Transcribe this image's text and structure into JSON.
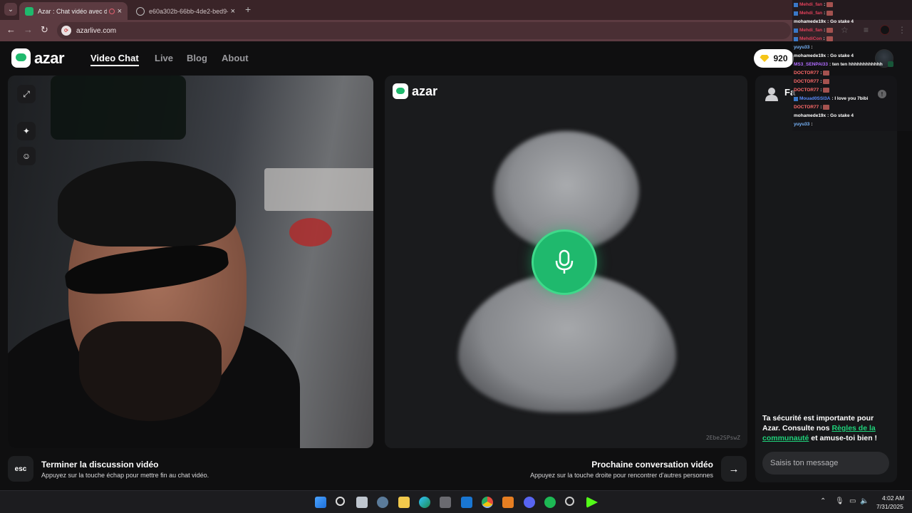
{
  "browser": {
    "tabs": [
      {
        "title": "Azar : Chat vidéo avec de n",
        "active": true
      },
      {
        "title": "e60a302b-66bb-4de2-bed9-5b",
        "active": false
      }
    ],
    "new_tab": "+",
    "url": "azarlive.com"
  },
  "header": {
    "logo_text": "azar",
    "nav": [
      "Video Chat",
      "Live",
      "Blog",
      "About"
    ],
    "gems": "920"
  },
  "remote": {
    "logo_text": "azar",
    "session_id": "2Ebe2SPswZ"
  },
  "chat_panel": {
    "partner_name": "Fa",
    "safety_part1": "Ta sécurité est importante pour Azar. Consulte nos ",
    "safety_link": "Règles de la communauté",
    "safety_part2": " et amuse-toi bien !",
    "input_placeholder": "Saisis ton message"
  },
  "bottom_bar": {
    "esc_label": "esc",
    "end_title": "Terminer la discussion vidéo",
    "end_hint": "Appuyez sur la touche échap pour mettre fin au chat vidéo.",
    "next_title": "Prochaine conversation vidéo",
    "next_hint": "Appuyez sur la touche droite pour rencontrer d'autres personnes"
  },
  "stream_chat": [
    {
      "user": "Mehdi_fan",
      "text": ":",
      "color": "#e0405a",
      "badge": true,
      "emote": true
    },
    {
      "user": "Mehdi_fan",
      "text": ":",
      "color": "#e0405a",
      "badge": true,
      "emote": true
    },
    {
      "user": "mohamede19x",
      "text": ": Go stake 4",
      "color": "#ffffff",
      "badge": false,
      "emote": false
    },
    {
      "user": "Mehdi_fan",
      "text": ":",
      "color": "#e0405a",
      "badge": true,
      "emote": true
    },
    {
      "user": "MehdiCon",
      "text": ":",
      "color": "#e0405a",
      "badge": true,
      "emote": true
    },
    {
      "user": "yuyu33",
      "text": ":",
      "color": "#7ab8ff",
      "badge": false,
      "emote": false
    },
    {
      "user": "mohamede19x",
      "text": ": Go stake 4",
      "color": "#ffffff",
      "badge": false,
      "emote": false
    },
    {
      "user": "MS3_SENPAI33",
      "text": ": ten ten hhhhhhhhhhhh",
      "color": "#b06cff",
      "badge": false,
      "emote": false
    },
    {
      "user": "DOCTOR77",
      "text": ":",
      "color": "#ff6a6a",
      "badge": false,
      "emote": true
    },
    {
      "user": "DOCTOR77",
      "text": ":",
      "color": "#ff6a6a",
      "badge": false,
      "emote": true
    },
    {
      "user": "DOCTOR77",
      "text": ":",
      "color": "#ff6a6a",
      "badge": false,
      "emote": true
    },
    {
      "user": "Mouad0SSI3A",
      "text": ": I love you 7bibi",
      "color": "#5a8cff",
      "badge": true,
      "emote": false
    },
    {
      "user": "DOCTOR77",
      "text": ":",
      "color": "#ff6a6a",
      "badge": false,
      "emote": true
    },
    {
      "user": "mohamede19x",
      "text": ": Go stake 4",
      "color": "#ffffff",
      "badge": false,
      "emote": false
    },
    {
      "user": "yuyu33",
      "text": ":",
      "color": "#7ab8ff",
      "badge": false,
      "emote": false
    }
  ],
  "taskbar": {
    "time": "4:02 AM",
    "date": "7/31/2025"
  },
  "colors": {
    "accent": "#1fb96d",
    "browser_frame": "#5c3b41",
    "page_bg": "#0f0f10"
  }
}
